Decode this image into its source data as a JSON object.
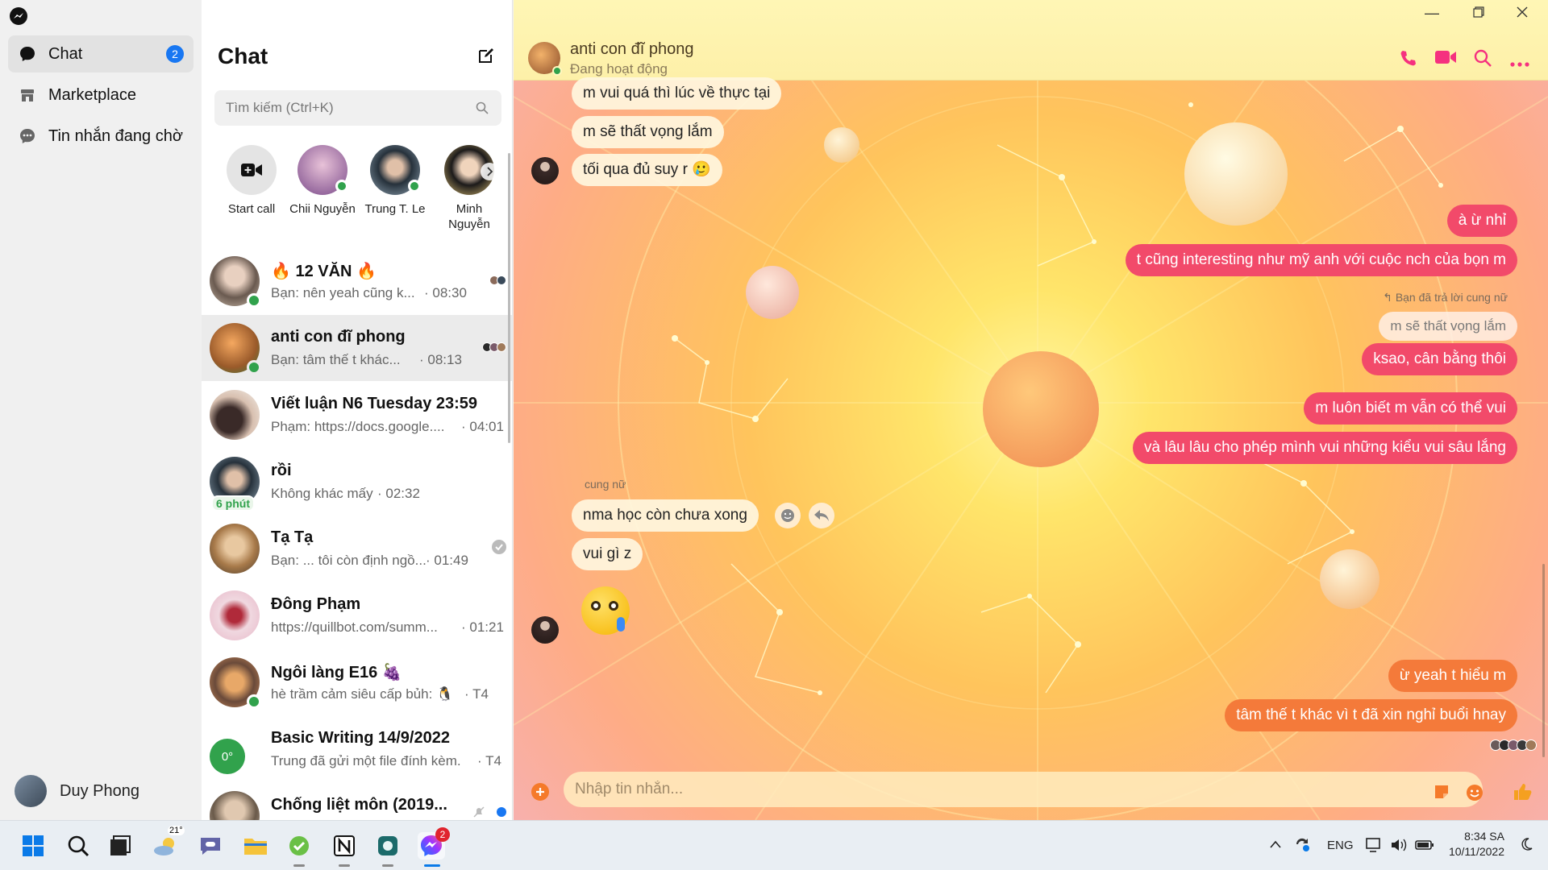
{
  "nav": {
    "items": [
      {
        "label": "Chat",
        "badge": "2"
      },
      {
        "label": "Marketplace"
      },
      {
        "label": "Tin nhắn đang chờ"
      }
    ],
    "me": "Duy Phong"
  },
  "list": {
    "title": "Chat",
    "search_placeholder": "Tìm kiếm (Ctrl+K)",
    "stories": [
      {
        "label": "Start call"
      },
      {
        "label": "Chii Nguyễn"
      },
      {
        "label": "Trung T. Le"
      },
      {
        "label": "Minh Nguyễn"
      }
    ],
    "conversations": [
      {
        "name": "🔥 12 VĂN 🔥",
        "preview": "Bạn: nên yeah cũng k...",
        "time": "· 08:30"
      },
      {
        "name": "anti con đĩ phong",
        "preview": "Bạn: tâm thế t khác...",
        "time": "· 08:13"
      },
      {
        "name": "Viết luận N6 Tuesday 23:59",
        "preview": "Phạm: https://docs.google....",
        "time": "· 04:01"
      },
      {
        "name": "rồi",
        "preview": "Không khác mấy",
        "time": "· 02:32",
        "badge": "6 phút"
      },
      {
        "name": "Tạ Tạ",
        "preview": "Bạn: ... tôi còn định ngồ...",
        "time": "· 01:49"
      },
      {
        "name": "Đông Phạm",
        "preview": "https://quillbot.com/summ...",
        "time": "· 01:21"
      },
      {
        "name": "Ngôi làng E16 🍇",
        "preview": "hè trầm cảm siêu cấp bủh: 🐧",
        "time": "· T4"
      },
      {
        "name": "Basic Writing 14/9/2022",
        "preview": "Trung đã gửi một file đính kèm.",
        "time": "· T4",
        "avatar_text": "0°"
      },
      {
        "name": "Chống liệt môn (2019..."
      }
    ]
  },
  "chat": {
    "peer_name": "anti con đĩ phong",
    "peer_status": "Đang hoạt động",
    "messages_in_top": [
      "m vui quá thì lúc về thực tại",
      "m sẽ thất vọng lắm",
      "tối qua đủ suy r 🥲"
    ],
    "messages_out_1": [
      "à ừ nhỉ",
      "t cũng interesting như mỹ anh với cuộc nch của bọn m"
    ],
    "reply_meta": "Bạn đã trả lời cung nữ",
    "reply_quote": "m sẽ thất vọng lắm",
    "messages_out_2": [
      "ksao, cân bằng thôi",
      "m luôn biết m vẫn có thể vui",
      "và lâu lâu cho phép mình vui những kiểu vui sâu lắng"
    ],
    "sender_label": "cung nữ",
    "messages_in_2": [
      "nma học còn chưa xong",
      "vui gì z"
    ],
    "messages_out_3": [
      "ừ yeah t hiểu m",
      "tâm thế t khác vì t đã xin nghỉ buổi hnay"
    ],
    "input_placeholder": "Nhập tin nhắn..."
  },
  "taskbar": {
    "weather": "21°",
    "messenger_badge": "2",
    "lang": "ENG",
    "time": "8:34 SA",
    "date": "10/11/2022"
  },
  "colors": {
    "accent": "#f24a6a",
    "orange_bubble": "#f47a3a",
    "messenger_blue": "#1877f2",
    "online": "#31a24c"
  }
}
